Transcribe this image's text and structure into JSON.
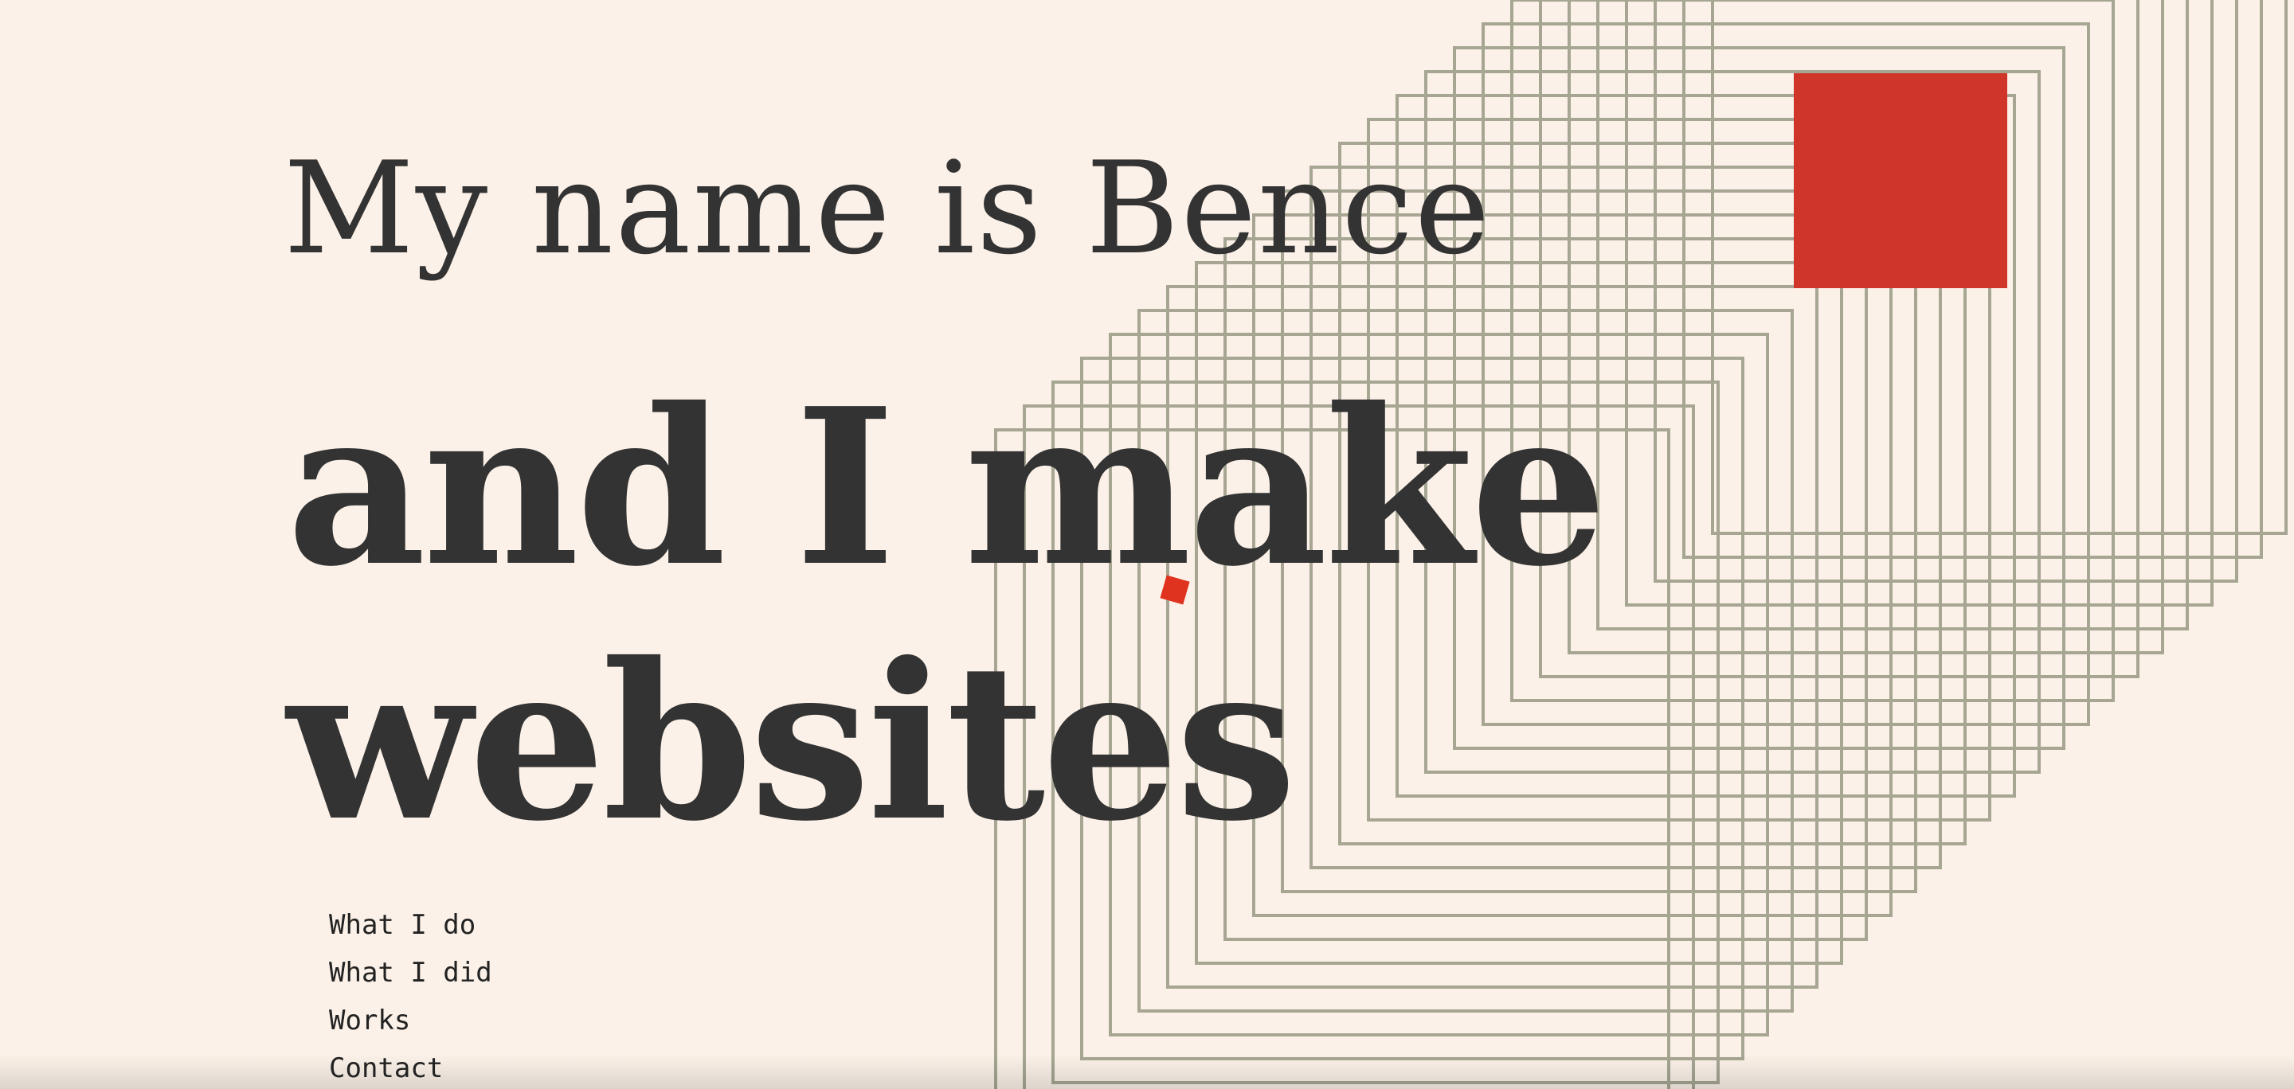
{
  "hero": {
    "intro": "My name is Bence",
    "headline_line1": "and I make",
    "headline_line2": "websites"
  },
  "nav": {
    "items": [
      {
        "label": "What I do"
      },
      {
        "label": "What I did"
      },
      {
        "label": "Works"
      },
      {
        "label": "Contact"
      }
    ]
  },
  "colors": {
    "background": "#fbf1e8",
    "text": "#333333",
    "accent": "#cf3529",
    "accent_small": "#e0331f",
    "line_art": "#a6a693"
  }
}
